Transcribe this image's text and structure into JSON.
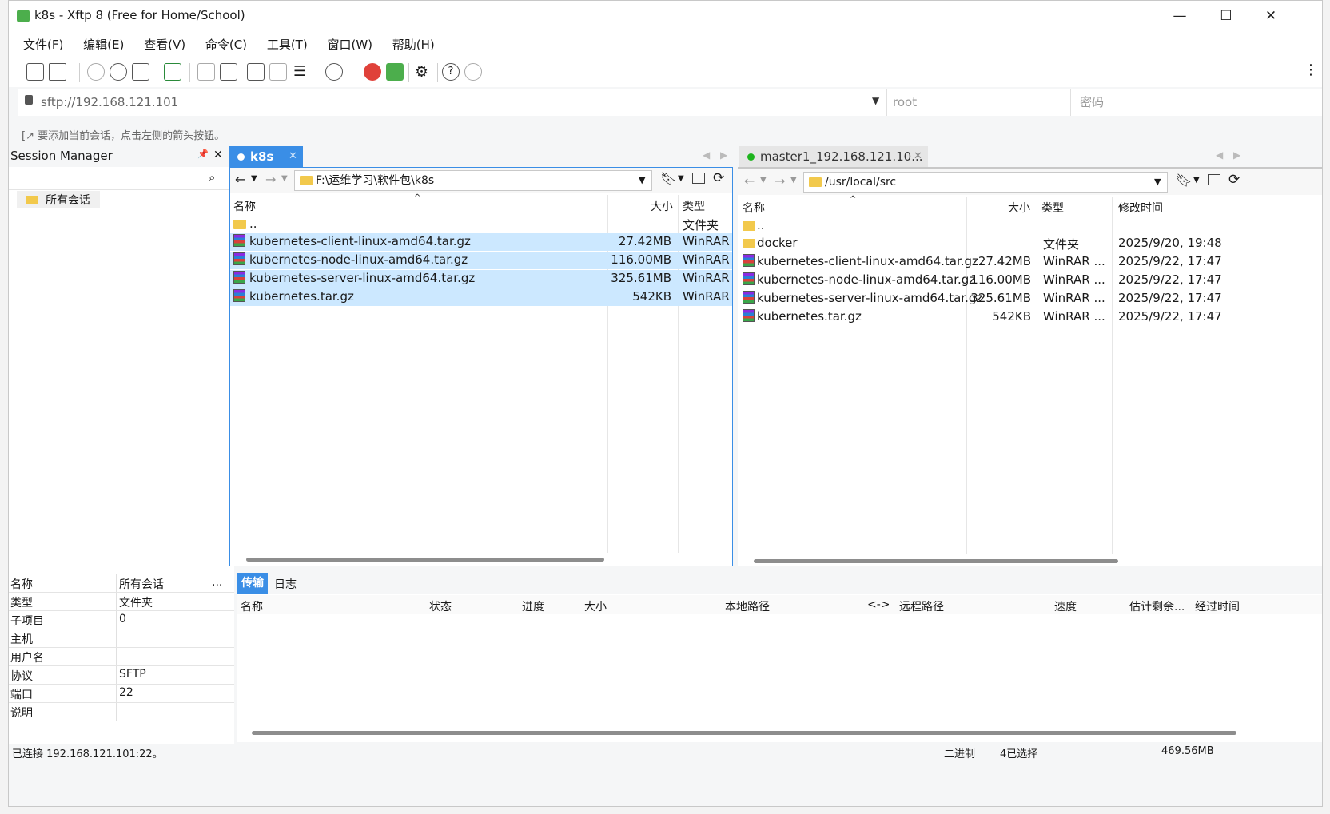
{
  "window": {
    "title": "k8s - Xftp 8 (Free for Home/School)",
    "controls": {
      "minimize": "—",
      "maximize": "☐",
      "close": "✕"
    }
  },
  "menu": [
    "文件(F)",
    "编辑(E)",
    "查看(V)",
    "命令(C)",
    "工具(T)",
    "窗口(W)",
    "帮助(H)"
  ],
  "address": {
    "url": "sftp://192.168.121.101",
    "user_placeholder": "root",
    "password_placeholder": "密码"
  },
  "hint": "要添加当前会话，点击左侧的箭头按钮。",
  "session_manager": {
    "title": "Session Manager",
    "pin": "📌",
    "close": "✕",
    "tree_root": "所有会话",
    "properties": [
      {
        "key": "名称",
        "value": "所有会话"
      },
      {
        "key": "类型",
        "value": "文件夹"
      },
      {
        "key": "子项目",
        "value": "0"
      },
      {
        "key": "主机",
        "value": ""
      },
      {
        "key": "用户名",
        "value": ""
      },
      {
        "key": "协议",
        "value": "SFTP"
      },
      {
        "key": "端口",
        "value": "22"
      },
      {
        "key": "说明",
        "value": ""
      }
    ],
    "more": "..."
  },
  "local": {
    "tab": "k8s",
    "path": "F:\\运维学习\\软件包\\k8s",
    "headers": {
      "name": "名称",
      "size": "大小",
      "type": "类型"
    },
    "rows": [
      {
        "name": "..",
        "size": "",
        "type": "文件夹",
        "icon": "folder",
        "selected": false
      },
      {
        "name": "kubernetes-client-linux-amd64.tar.gz",
        "size": "27.42MB",
        "type": "WinRAR ...",
        "icon": "rar",
        "selected": true
      },
      {
        "name": "kubernetes-node-linux-amd64.tar.gz",
        "size": "116.00MB",
        "type": "WinRAR ...",
        "icon": "rar",
        "selected": true
      },
      {
        "name": "kubernetes-server-linux-amd64.tar.gz",
        "size": "325.61MB",
        "type": "WinRAR ...",
        "icon": "rar",
        "selected": true
      },
      {
        "name": "kubernetes.tar.gz",
        "size": "542KB",
        "type": "WinRAR ...",
        "icon": "rar",
        "selected": true
      }
    ]
  },
  "remote": {
    "tab": "master1_192.168.121.10...",
    "path": "/usr/local/src",
    "headers": {
      "name": "名称",
      "size": "大小",
      "type": "类型",
      "modified": "修改时间"
    },
    "rows": [
      {
        "name": "..",
        "size": "",
        "type": "",
        "modified": "",
        "icon": "folder"
      },
      {
        "name": "docker",
        "size": "",
        "type": "文件夹",
        "modified": "2025/9/20, 19:48",
        "icon": "folder"
      },
      {
        "name": "kubernetes-client-linux-amd64.tar.gz",
        "size": "27.42MB",
        "type": "WinRAR ...",
        "modified": "2025/9/22, 17:47",
        "icon": "rar"
      },
      {
        "name": "kubernetes-node-linux-amd64.tar.gz",
        "size": "116.00MB",
        "type": "WinRAR ...",
        "modified": "2025/9/22, 17:47",
        "icon": "rar"
      },
      {
        "name": "kubernetes-server-linux-amd64.tar.gz",
        "size": "325.61MB",
        "type": "WinRAR ...",
        "modified": "2025/9/22, 17:47",
        "icon": "rar"
      },
      {
        "name": "kubernetes.tar.gz",
        "size": "542KB",
        "type": "WinRAR ...",
        "modified": "2025/9/22, 17:47",
        "icon": "rar"
      }
    ]
  },
  "transfer": {
    "tabs": [
      "传输",
      "日志"
    ],
    "headers": [
      "名称",
      "状态",
      "进度",
      "大小",
      "本地路径",
      "<->",
      "远程路径",
      "速度",
      "估计剩余...",
      "经过时间"
    ]
  },
  "status": {
    "connection": "已连接 192.168.121.101:22。",
    "mode": "二进制",
    "selection": "4已选择",
    "total": "469.56MB"
  },
  "colors": {
    "accent": "#3a8ee6",
    "selection": "#cce8ff",
    "connected": "#1db41d"
  }
}
